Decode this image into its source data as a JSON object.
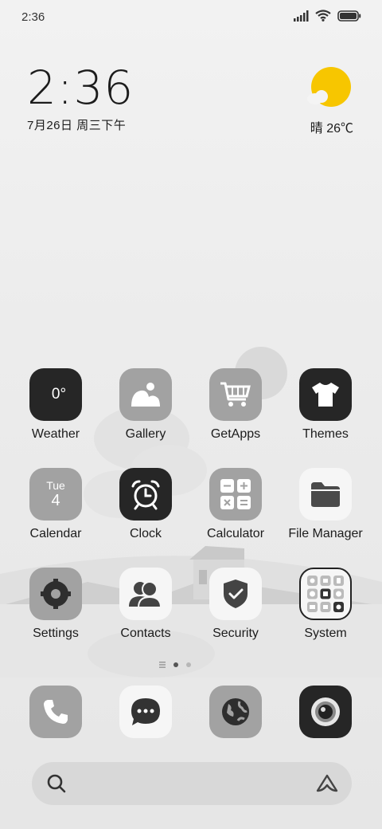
{
  "status_bar": {
    "time": "2:36",
    "icons": [
      "signal-icon",
      "wifi-icon",
      "battery-icon"
    ]
  },
  "clock_widget": {
    "time": "2:36",
    "date": "7月26日 周三下午"
  },
  "weather_widget": {
    "condition_temp": "晴 26℃",
    "icon": "sun-cloud-icon",
    "sun_color": "#f7c600"
  },
  "apps": [
    {
      "label": "Weather",
      "icon": "weather-icon",
      "icon_text": "0°"
    },
    {
      "label": "Gallery",
      "icon": "gallery-icon"
    },
    {
      "label": "GetApps",
      "icon": "cart-icon"
    },
    {
      "label": "Themes",
      "icon": "tshirt-icon"
    },
    {
      "label": "Calendar",
      "icon": "calendar-icon",
      "icon_day": "Tue",
      "icon_date": "4"
    },
    {
      "label": "Clock",
      "icon": "alarm-clock-icon"
    },
    {
      "label": "Calculator",
      "icon": "calculator-icon"
    },
    {
      "label": "File Manager",
      "icon": "folder-icon"
    },
    {
      "label": "Settings",
      "icon": "gear-icon"
    },
    {
      "label": "Contacts",
      "icon": "contacts-icon"
    },
    {
      "label": "Security",
      "icon": "shield-icon"
    },
    {
      "label": "System",
      "icon": "folder-grid-icon"
    }
  ],
  "dock": [
    "phone-icon",
    "messages-icon",
    "browser-icon",
    "camera-icon"
  ],
  "search": {
    "icon": "search-icon",
    "assistant_icon": "assistant-icon"
  }
}
